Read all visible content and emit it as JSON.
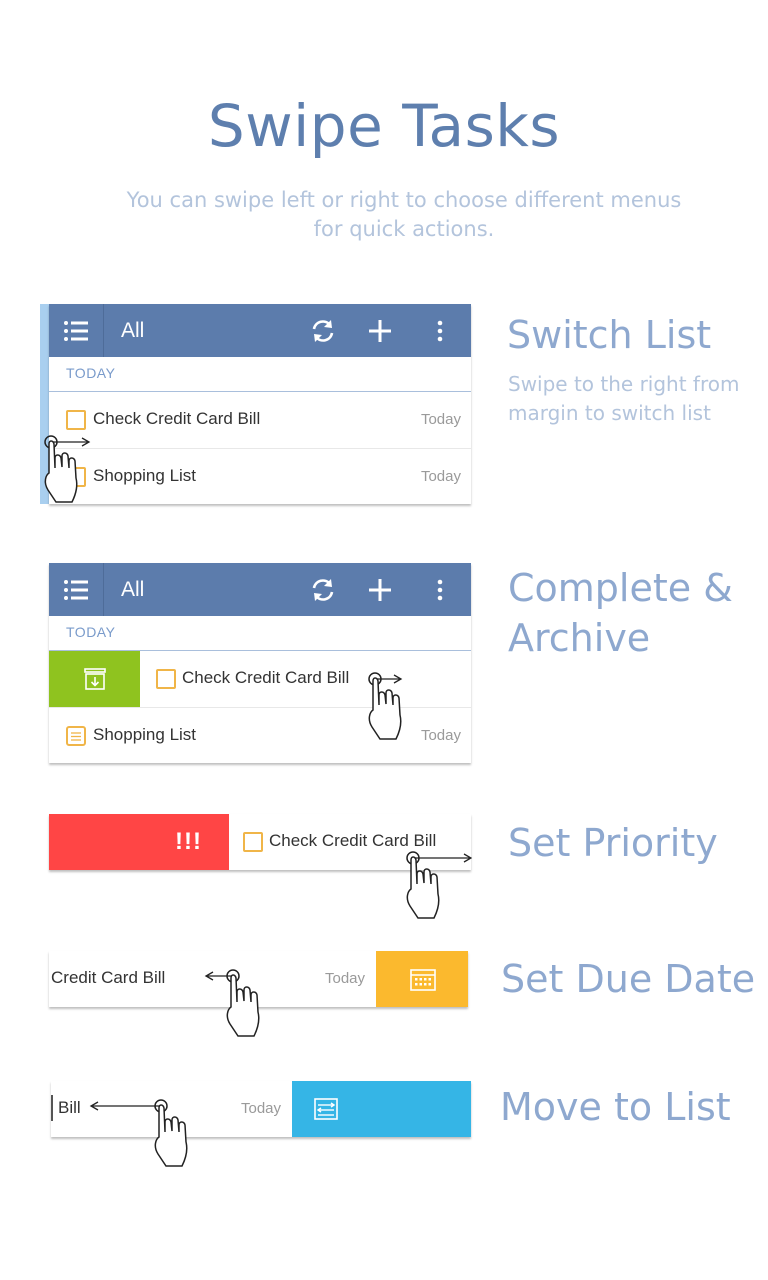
{
  "header": {
    "title": "Swipe Tasks",
    "subtitle_line1": "You can swipe left or right to choose different menus",
    "subtitle_line2": "for quick actions."
  },
  "app": {
    "list_name": "All",
    "section_label": "TODAY",
    "task1": "Check Credit Card Bill",
    "task2": "Shopping List",
    "date_label": "Today",
    "priority_mark": "!!!",
    "partial_task_due": "Credit Card Bill",
    "partial_task_move": "Bill"
  },
  "features": {
    "switch_list": {
      "title": "Switch List",
      "desc_line1": "Swipe to the right from",
      "desc_line2": "margin to switch list"
    },
    "complete_archive": {
      "title_line1": "Complete &",
      "title_line2": "Archive"
    },
    "set_priority": {
      "title": "Set Priority"
    },
    "set_due_date": {
      "title": "Set Due Date"
    },
    "move_to_list": {
      "title": "Move to List"
    }
  },
  "colors": {
    "toolbar": "#5c7cac",
    "archive_green": "#8fc31f",
    "priority_red": "#ff4545",
    "due_date_yellow": "#fbb92e",
    "move_blue": "#35b5e6",
    "accent_text": "#8ea8cf"
  },
  "icons": [
    "menu-icon",
    "sync-icon",
    "add-icon",
    "more-icon",
    "archive-icon",
    "calendar-icon",
    "move-list-icon",
    "swipe-hand-icon",
    "checkbox-icon",
    "list-note-icon"
  ]
}
